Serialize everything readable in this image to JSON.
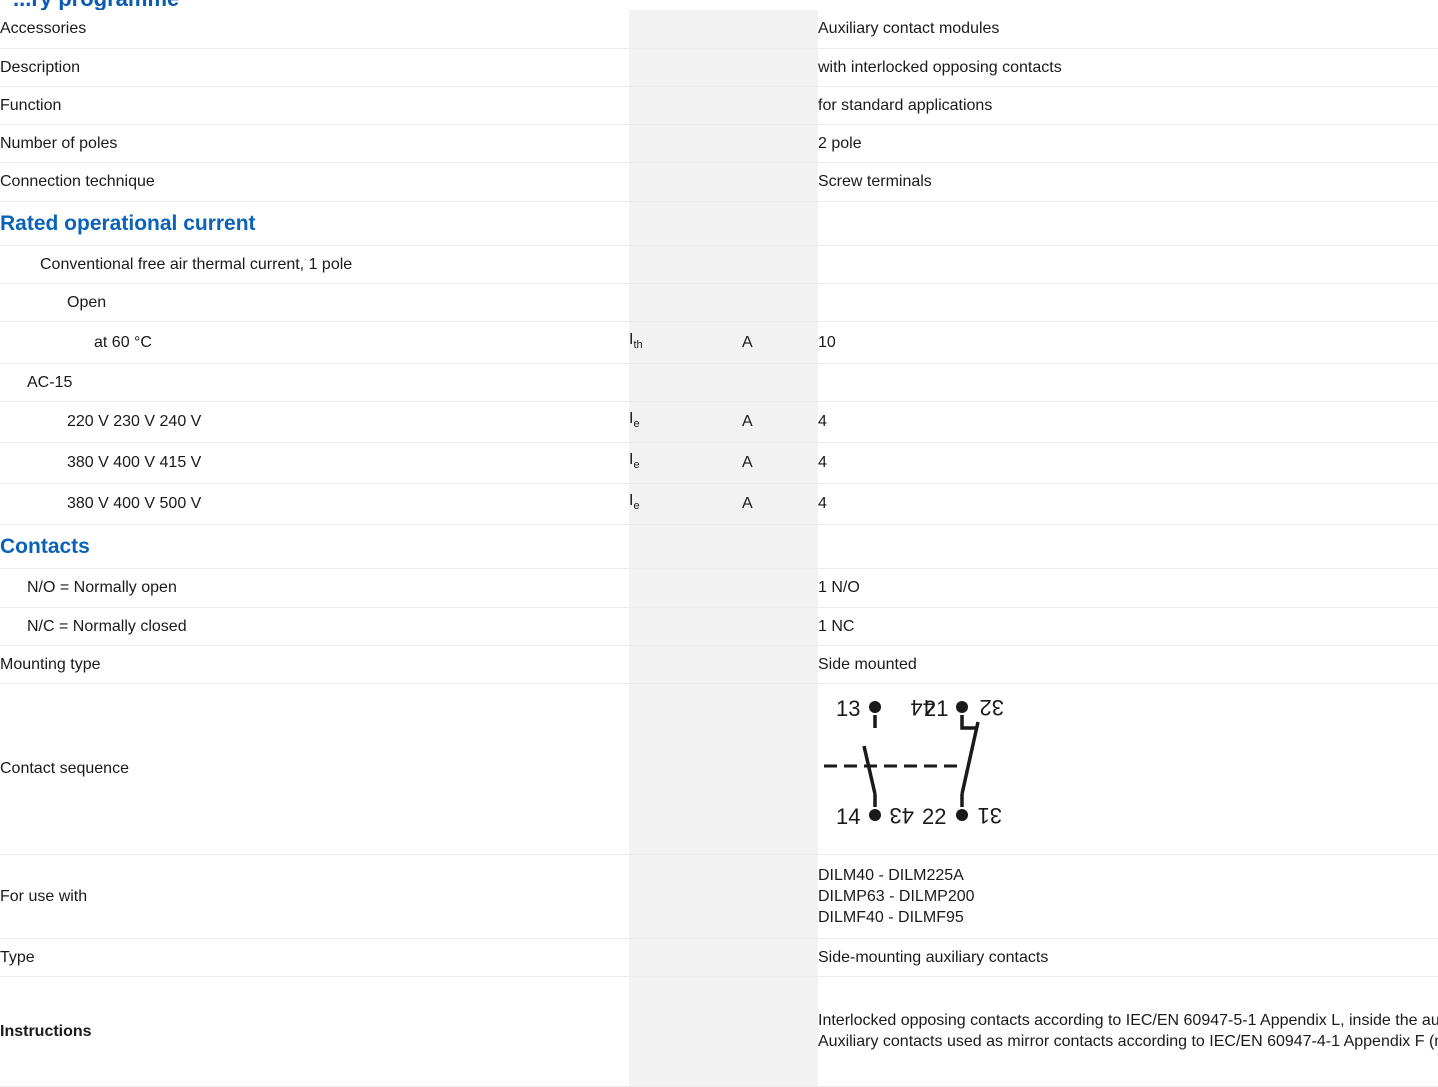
{
  "header": {
    "partial_heading": "...ry programme"
  },
  "rows": [
    {
      "label": "Accessories",
      "value": "Auxiliary contact modules"
    },
    {
      "label": "Description",
      "value": "with interlocked opposing contacts"
    },
    {
      "label": "Function",
      "value": "for standard applications"
    },
    {
      "label": "Number of poles",
      "value": "2 pole"
    },
    {
      "label": "Connection technique",
      "value": "Screw terminals"
    }
  ],
  "section_current": {
    "title": "Rated operational current",
    "conv_label": "Conventional free air thermal current, 1 pole",
    "open_label": "Open",
    "at60": {
      "label": "at 60 °C",
      "sym": "I",
      "sub": "th",
      "unit": "A",
      "value": "10"
    },
    "ac15_label": "AC-15",
    "ac15_rows": [
      {
        "label": "220 V 230 V 240 V",
        "sym": "I",
        "sub": "e",
        "unit": "A",
        "value": "4"
      },
      {
        "label": "380 V 400 V 415 V",
        "sym": "I",
        "sub": "e",
        "unit": "A",
        "value": "4"
      },
      {
        "label": "380 V 400 V 500 V",
        "sym": "I",
        "sub": "e",
        "unit": "A",
        "value": "4"
      }
    ]
  },
  "section_contacts": {
    "title": "Contacts",
    "no": {
      "label": "N/O = Normally open",
      "value": "1 N/O"
    },
    "nc": {
      "label": "N/C = Normally closed",
      "value": "1 NC"
    }
  },
  "mounting": {
    "label": "Mounting type",
    "value": "Side mounted"
  },
  "sequence": {
    "label": "Contact sequence",
    "terminals": {
      "t13": "13",
      "t44": "44",
      "t21": "21",
      "t32": "32",
      "t14": "14",
      "t43": "43",
      "t22": "22",
      "t31": "31"
    }
  },
  "for_use": {
    "label": "For use with",
    "lines": [
      "DILM40 - DILM225A",
      "DILMP63 - DILMP200",
      "DILMF40 - DILMF95"
    ]
  },
  "type": {
    "label": "Type",
    "value": "Side-mounting auxiliary contacts"
  },
  "instructions": {
    "label": "Instructions",
    "line1": "Interlocked opposing contacts according to IEC/EN 60947-5-1 Appendix L, inside the auxiliary contact module",
    "line2": "Auxiliary contacts used as mirror contacts according to IEC/EN 60947-4-1 Appendix F (not N/C late open)"
  },
  "colors": {
    "accent": "#0a63b8",
    "column_shade": "#f2f2f2",
    "row_rule": "#ececec"
  }
}
